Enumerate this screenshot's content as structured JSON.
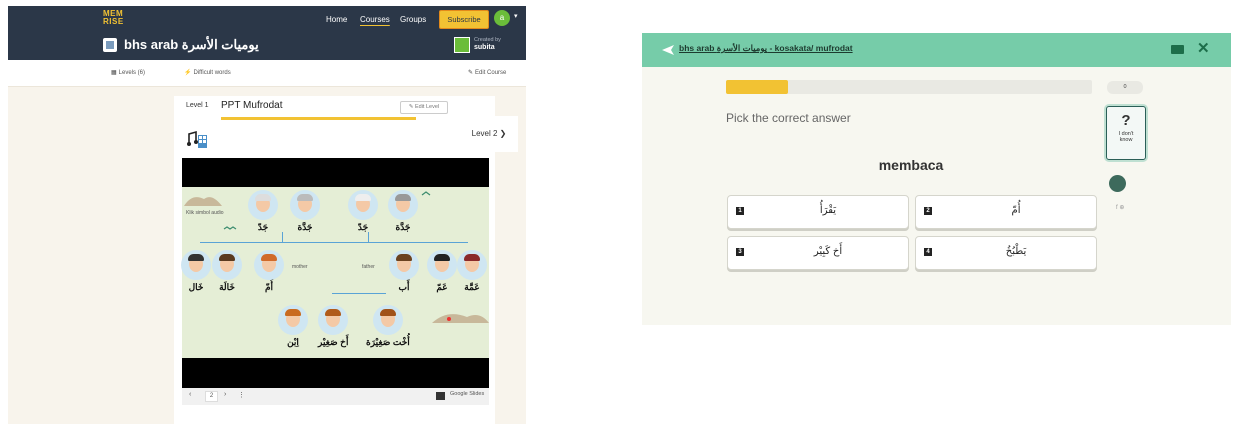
{
  "left": {
    "nav": {
      "logo": "MEM RISE",
      "links": [
        "Home",
        "Courses",
        "Groups"
      ],
      "subscribe": "Subscribe",
      "avatar_initial": "a",
      "caret": "▾"
    },
    "course": {
      "title": "bhs arab يوميات الأسرة",
      "created_by": "Created by",
      "creator": "subita"
    },
    "subnav": {
      "levels": "Levels (6)",
      "difficult": "Difficult words",
      "edit_course": "Edit Course"
    },
    "level": {
      "label": "Level 1",
      "title": "PPT Mufrodat",
      "edit_label": "Edit Level",
      "next": "Level 2 ❯"
    },
    "slide": {
      "audio_caption": "Klik simbol audio",
      "grandparents_left": [
        "جَدّ",
        "جَدَّة"
      ],
      "grandparents_right": [
        "جَدّ",
        "جَدَّة"
      ],
      "middle": [
        "خَال",
        "خَالَة",
        "أُمّ",
        "أَب",
        "عَمّ",
        "عَمَّة"
      ],
      "mother_label": "mother",
      "father_label": "father",
      "children": [
        "اِبْن",
        "أَخ صَغِيْر",
        "أُخْت صَغِيْرَة"
      ],
      "toolbar": {
        "prev": "‹",
        "page": "2",
        "next": "›",
        "more": "⋮",
        "brand": "Google Slides"
      }
    }
  },
  "right": {
    "breadcrumb": "bhs arab يوميات الأسرة - kosakata/ mufrodat",
    "close": "✕",
    "progress_fraction": 0.17,
    "points": "0",
    "prompt": "Pick the correct answer",
    "idk_q": "?",
    "idk_label": "I don't know",
    "word": "membaca",
    "social": "f ⊕",
    "options": [
      {
        "num": "1",
        "text": "يَقْرَأُ"
      },
      {
        "num": "2",
        "text": "أُمّ"
      },
      {
        "num": "3",
        "text": "أَخ كَبِيْر"
      },
      {
        "num": "4",
        "text": "يَطْبُخُ"
      }
    ]
  }
}
